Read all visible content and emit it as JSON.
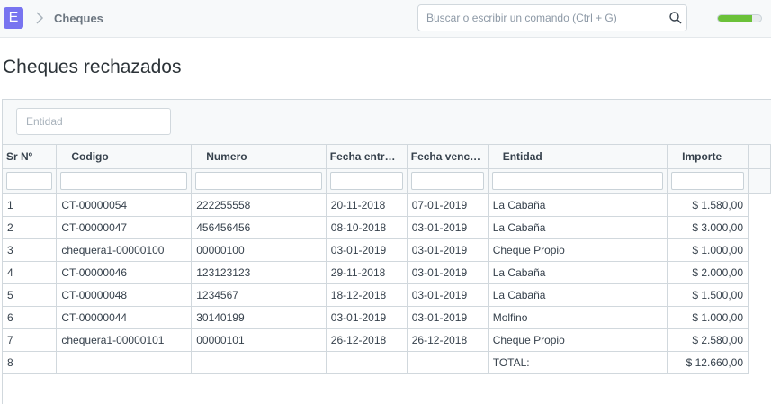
{
  "app": {
    "logo_letter": "E",
    "breadcrumb": "Cheques"
  },
  "search": {
    "placeholder": "Buscar o escribir un comando (Ctrl + G)"
  },
  "progress": {
    "fraction": 0.8,
    "color": "#6bc139"
  },
  "page": {
    "title": "Cheques rechazados"
  },
  "filters": {
    "entidad_placeholder": "Entidad"
  },
  "columns": [
    "Sr Nº",
    "Codigo",
    "Numero",
    "Fecha entr…",
    "Fecha venc…",
    "Entidad",
    "Importe"
  ],
  "rows": [
    [
      "1",
      "CT-00000054",
      "222255558",
      "20-11-2018",
      "07-01-2019",
      "La Cabaña",
      "$ 1.580,00"
    ],
    [
      "2",
      "CT-00000047",
      "456456456",
      "08-10-2018",
      "03-01-2019",
      "La Cabaña",
      "$ 3.000,00"
    ],
    [
      "3",
      "chequera1-00000100",
      "00000100",
      "03-01-2019",
      "03-01-2019",
      "Cheque Propio",
      "$ 1.000,00"
    ],
    [
      "4",
      "CT-00000046",
      "123123123",
      "29-11-2018",
      "03-01-2019",
      "La Cabaña",
      "$ 2.000,00"
    ],
    [
      "5",
      "CT-00000048",
      "1234567",
      "18-12-2018",
      "03-01-2019",
      "La Cabaña",
      "$ 1.500,00"
    ],
    [
      "6",
      "CT-00000044",
      "30140199",
      "03-01-2019",
      "03-01-2019",
      "Molfino",
      "$ 1.000,00"
    ],
    [
      "7",
      "chequera1-00000101",
      "00000101",
      "26-12-2018",
      "26-12-2018",
      "Cheque Propio",
      "$ 2.580,00"
    ],
    [
      "8",
      "",
      "",
      "",
      "",
      "TOTAL:",
      "$ 12.660,00"
    ]
  ],
  "colors": {
    "accent": "#7874f0",
    "border": "#d1d8dd",
    "header_bg": "#f7f9fa"
  }
}
